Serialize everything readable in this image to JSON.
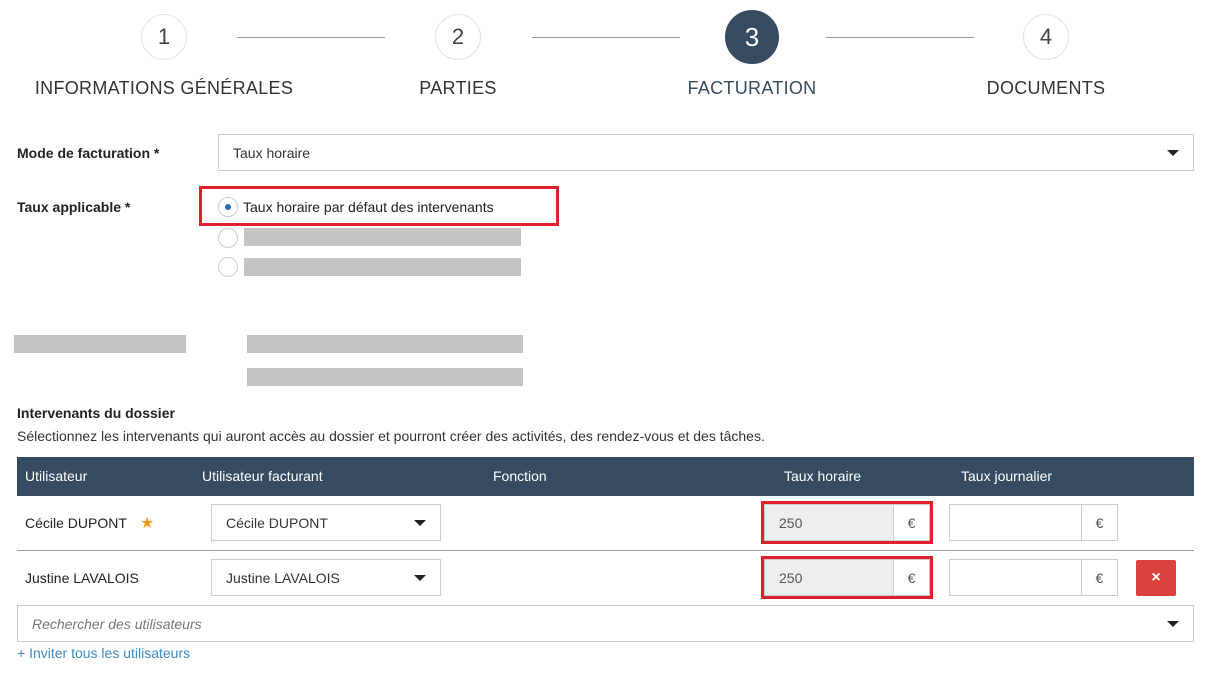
{
  "stepper": {
    "steps": [
      {
        "number": "1",
        "label": "INFORMATIONS GÉNÉRALES",
        "active": false
      },
      {
        "number": "2",
        "label": "PARTIES",
        "active": false
      },
      {
        "number": "3",
        "label": "FACTURATION",
        "active": true
      },
      {
        "number": "4",
        "label": "DOCUMENTS",
        "active": false
      }
    ]
  },
  "billing_mode": {
    "label": "Mode de facturation *",
    "value": "Taux horaire"
  },
  "applicable_rate": {
    "label": "Taux applicable *",
    "options": [
      {
        "label": "Taux horaire par défaut des intervenants",
        "checked": true
      },
      {
        "label": "",
        "checked": false
      },
      {
        "label": "",
        "checked": false
      }
    ]
  },
  "participants": {
    "title": "Intervenants du dossier",
    "description": "Sélectionnez les intervenants qui auront accès au dossier et pourront créer des activités, des rendez-vous et des tâches.",
    "columns": [
      "Utilisateur",
      "Utilisateur facturant",
      "Fonction",
      "Taux horaire",
      "Taux journalier"
    ],
    "rows": [
      {
        "user": "Cécile DUPONT",
        "starred": true,
        "billing_user": "Cécile DUPONT",
        "function": "",
        "hourly_rate": "250",
        "hourly_currency": "€",
        "daily_rate": "",
        "daily_currency": "€",
        "deletable": false
      },
      {
        "user": "Justine LAVALOIS",
        "starred": false,
        "billing_user": "Justine LAVALOIS",
        "function": "",
        "hourly_rate": "250",
        "hourly_currency": "€",
        "daily_rate": "",
        "daily_currency": "€",
        "deletable": true
      }
    ],
    "search_placeholder": "Rechercher des utilisateurs",
    "invite_label": "+ Inviter tous les utilisateurs",
    "delete_icon": "×"
  },
  "colors": {
    "header_bg": "#354b61",
    "highlight": "#e0202a",
    "delete": "#d9413a",
    "link": "#3a8bc9",
    "star": "#f0a020"
  }
}
